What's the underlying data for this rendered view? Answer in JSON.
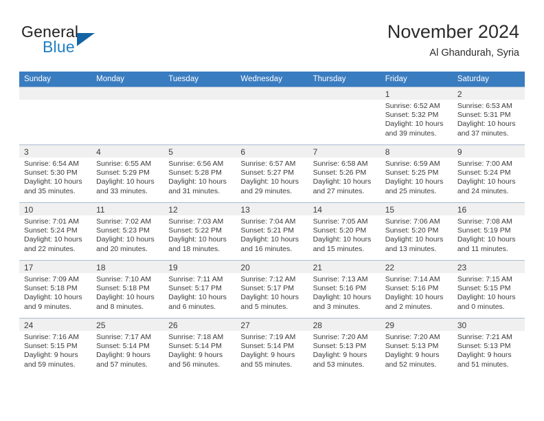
{
  "brand": {
    "name_part1": "General",
    "name_part2": "Blue",
    "logo_icon": "triangle-logo-icon"
  },
  "header": {
    "title": "November 2024",
    "location": "Al Ghandurah, Syria"
  },
  "colors": {
    "header_blue": "#3a7cc0",
    "brand_blue": "#1f7fc4",
    "logo_blue": "#1464a5",
    "date_band_gray": "#f0f0f0",
    "grid_line": "#a8bdd2",
    "text": "#3a3a3a"
  },
  "calendar": {
    "weekday_headers": [
      "Sunday",
      "Monday",
      "Tuesday",
      "Wednesday",
      "Thursday",
      "Friday",
      "Saturday"
    ],
    "weeks": [
      [
        {
          "empty": true
        },
        {
          "empty": true
        },
        {
          "empty": true
        },
        {
          "empty": true
        },
        {
          "empty": true
        },
        {
          "day": "1",
          "sunrise": "Sunrise: 6:52 AM",
          "sunset": "Sunset: 5:32 PM",
          "daylight_line1": "Daylight: 10 hours",
          "daylight_line2": "and 39 minutes."
        },
        {
          "day": "2",
          "sunrise": "Sunrise: 6:53 AM",
          "sunset": "Sunset: 5:31 PM",
          "daylight_line1": "Daylight: 10 hours",
          "daylight_line2": "and 37 minutes."
        }
      ],
      [
        {
          "day": "3",
          "sunrise": "Sunrise: 6:54 AM",
          "sunset": "Sunset: 5:30 PM",
          "daylight_line1": "Daylight: 10 hours",
          "daylight_line2": "and 35 minutes."
        },
        {
          "day": "4",
          "sunrise": "Sunrise: 6:55 AM",
          "sunset": "Sunset: 5:29 PM",
          "daylight_line1": "Daylight: 10 hours",
          "daylight_line2": "and 33 minutes."
        },
        {
          "day": "5",
          "sunrise": "Sunrise: 6:56 AM",
          "sunset": "Sunset: 5:28 PM",
          "daylight_line1": "Daylight: 10 hours",
          "daylight_line2": "and 31 minutes."
        },
        {
          "day": "6",
          "sunrise": "Sunrise: 6:57 AM",
          "sunset": "Sunset: 5:27 PM",
          "daylight_line1": "Daylight: 10 hours",
          "daylight_line2": "and 29 minutes."
        },
        {
          "day": "7",
          "sunrise": "Sunrise: 6:58 AM",
          "sunset": "Sunset: 5:26 PM",
          "daylight_line1": "Daylight: 10 hours",
          "daylight_line2": "and 27 minutes."
        },
        {
          "day": "8",
          "sunrise": "Sunrise: 6:59 AM",
          "sunset": "Sunset: 5:25 PM",
          "daylight_line1": "Daylight: 10 hours",
          "daylight_line2": "and 25 minutes."
        },
        {
          "day": "9",
          "sunrise": "Sunrise: 7:00 AM",
          "sunset": "Sunset: 5:24 PM",
          "daylight_line1": "Daylight: 10 hours",
          "daylight_line2": "and 24 minutes."
        }
      ],
      [
        {
          "day": "10",
          "sunrise": "Sunrise: 7:01 AM",
          "sunset": "Sunset: 5:24 PM",
          "daylight_line1": "Daylight: 10 hours",
          "daylight_line2": "and 22 minutes."
        },
        {
          "day": "11",
          "sunrise": "Sunrise: 7:02 AM",
          "sunset": "Sunset: 5:23 PM",
          "daylight_line1": "Daylight: 10 hours",
          "daylight_line2": "and 20 minutes."
        },
        {
          "day": "12",
          "sunrise": "Sunrise: 7:03 AM",
          "sunset": "Sunset: 5:22 PM",
          "daylight_line1": "Daylight: 10 hours",
          "daylight_line2": "and 18 minutes."
        },
        {
          "day": "13",
          "sunrise": "Sunrise: 7:04 AM",
          "sunset": "Sunset: 5:21 PM",
          "daylight_line1": "Daylight: 10 hours",
          "daylight_line2": "and 16 minutes."
        },
        {
          "day": "14",
          "sunrise": "Sunrise: 7:05 AM",
          "sunset": "Sunset: 5:20 PM",
          "daylight_line1": "Daylight: 10 hours",
          "daylight_line2": "and 15 minutes."
        },
        {
          "day": "15",
          "sunrise": "Sunrise: 7:06 AM",
          "sunset": "Sunset: 5:20 PM",
          "daylight_line1": "Daylight: 10 hours",
          "daylight_line2": "and 13 minutes."
        },
        {
          "day": "16",
          "sunrise": "Sunrise: 7:08 AM",
          "sunset": "Sunset: 5:19 PM",
          "daylight_line1": "Daylight: 10 hours",
          "daylight_line2": "and 11 minutes."
        }
      ],
      [
        {
          "day": "17",
          "sunrise": "Sunrise: 7:09 AM",
          "sunset": "Sunset: 5:18 PM",
          "daylight_line1": "Daylight: 10 hours",
          "daylight_line2": "and 9 minutes."
        },
        {
          "day": "18",
          "sunrise": "Sunrise: 7:10 AM",
          "sunset": "Sunset: 5:18 PM",
          "daylight_line1": "Daylight: 10 hours",
          "daylight_line2": "and 8 minutes."
        },
        {
          "day": "19",
          "sunrise": "Sunrise: 7:11 AM",
          "sunset": "Sunset: 5:17 PM",
          "daylight_line1": "Daylight: 10 hours",
          "daylight_line2": "and 6 minutes."
        },
        {
          "day": "20",
          "sunrise": "Sunrise: 7:12 AM",
          "sunset": "Sunset: 5:17 PM",
          "daylight_line1": "Daylight: 10 hours",
          "daylight_line2": "and 5 minutes."
        },
        {
          "day": "21",
          "sunrise": "Sunrise: 7:13 AM",
          "sunset": "Sunset: 5:16 PM",
          "daylight_line1": "Daylight: 10 hours",
          "daylight_line2": "and 3 minutes."
        },
        {
          "day": "22",
          "sunrise": "Sunrise: 7:14 AM",
          "sunset": "Sunset: 5:16 PM",
          "daylight_line1": "Daylight: 10 hours",
          "daylight_line2": "and 2 minutes."
        },
        {
          "day": "23",
          "sunrise": "Sunrise: 7:15 AM",
          "sunset": "Sunset: 5:15 PM",
          "daylight_line1": "Daylight: 10 hours",
          "daylight_line2": "and 0 minutes."
        }
      ],
      [
        {
          "day": "24",
          "sunrise": "Sunrise: 7:16 AM",
          "sunset": "Sunset: 5:15 PM",
          "daylight_line1": "Daylight: 9 hours",
          "daylight_line2": "and 59 minutes."
        },
        {
          "day": "25",
          "sunrise": "Sunrise: 7:17 AM",
          "sunset": "Sunset: 5:14 PM",
          "daylight_line1": "Daylight: 9 hours",
          "daylight_line2": "and 57 minutes."
        },
        {
          "day": "26",
          "sunrise": "Sunrise: 7:18 AM",
          "sunset": "Sunset: 5:14 PM",
          "daylight_line1": "Daylight: 9 hours",
          "daylight_line2": "and 56 minutes."
        },
        {
          "day": "27",
          "sunrise": "Sunrise: 7:19 AM",
          "sunset": "Sunset: 5:14 PM",
          "daylight_line1": "Daylight: 9 hours",
          "daylight_line2": "and 55 minutes."
        },
        {
          "day": "28",
          "sunrise": "Sunrise: 7:20 AM",
          "sunset": "Sunset: 5:13 PM",
          "daylight_line1": "Daylight: 9 hours",
          "daylight_line2": "and 53 minutes."
        },
        {
          "day": "29",
          "sunrise": "Sunrise: 7:20 AM",
          "sunset": "Sunset: 5:13 PM",
          "daylight_line1": "Daylight: 9 hours",
          "daylight_line2": "and 52 minutes."
        },
        {
          "day": "30",
          "sunrise": "Sunrise: 7:21 AM",
          "sunset": "Sunset: 5:13 PM",
          "daylight_line1": "Daylight: 9 hours",
          "daylight_line2": "and 51 minutes."
        }
      ]
    ]
  }
}
